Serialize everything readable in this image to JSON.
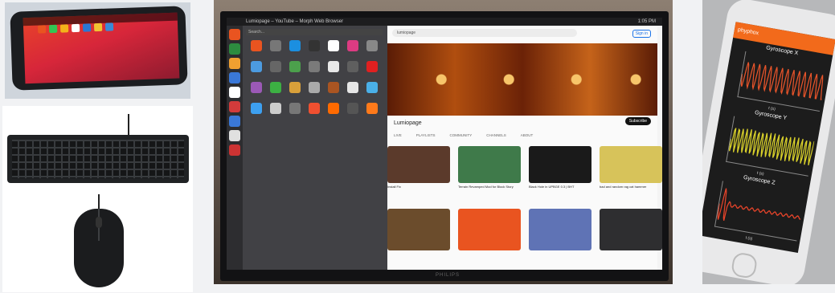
{
  "phone": {
    "icon_colors": [
      "#e95420",
      "#33c653",
      "#f3b31a",
      "#ffffff",
      "#2b77d3",
      "#f1c232",
      "#3a8ad8"
    ]
  },
  "monitor": {
    "topbar_title": "Lumiopage – YouTube – Morph Web Browser",
    "topbar_status": "1:05 PM",
    "drawer_search": "Search...",
    "url": "lumiopage",
    "sign_in": "Sign in",
    "channel_name": "Lumiopage",
    "subscribe_label": "Subscribe",
    "tabs": [
      "LIVE",
      "PLAYLISTS",
      "COMMUNITY",
      "CHANNELS",
      "ABOUT"
    ],
    "videos": [
      {
        "title": "Install Fix",
        "color": "#5b3a2b"
      },
      {
        "title": "Terrain Revamped Mod for Block Story",
        "color": "#3f7a4a"
      },
      {
        "title": "Black Hole in UPBGE 0.3 | BHT",
        "color": "#1a1a1a"
      },
      {
        "title": "bad and random rag cat hammer",
        "color": "#d7c35a"
      }
    ],
    "videos_row2": [
      "#6b4c2c",
      "#e95420",
      "#5f73b5",
      "#2e2e30"
    ],
    "brand": "PHILIPS",
    "launcher_colors": [
      "#e95420",
      "#2d8c3f",
      "#f0a030",
      "#3a78d8",
      "#ffffff",
      "#d23b3b",
      "#3a78d8",
      "#e0e0e0",
      "#cc3333"
    ],
    "drawer_colors": [
      "#e95420",
      "#777",
      "#1b8fe0",
      "#333",
      "#ffffff",
      "#dd3b82",
      "#888",
      "#4c9be0",
      "#666",
      "#4ca04c",
      "#7a7a7a",
      "#e8e8e8",
      "#5f5f5f",
      "#e02020",
      "#9b59b6",
      "#3cb043",
      "#d9a03a",
      "#aaaaaa",
      "#aa5522",
      "#e6e6e6",
      "#4ab0e8",
      "#3da0f0",
      "#ccc",
      "#777",
      "#f05030",
      "#ff6a00",
      "#555",
      "#ff7a1a"
    ]
  },
  "sensor_phone": {
    "app_name": "phyphox",
    "plot_titles": [
      "Gyroscope X",
      "Gyroscope Y",
      "Gyroscope Z"
    ],
    "plot_colors": [
      "#e8542a",
      "#d8d02a",
      "#e8442a"
    ],
    "x_label": "t (s)"
  }
}
